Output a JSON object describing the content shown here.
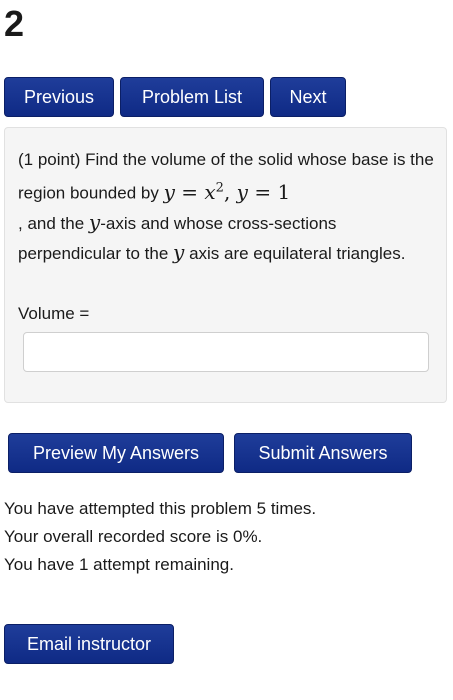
{
  "header": {
    "page_number": "2"
  },
  "nav": {
    "previous_label": "Previous",
    "problem_list_label": "Problem List",
    "next_label": "Next"
  },
  "problem": {
    "points": "(1 point)",
    "text_part1": "Find the volume of the solid whose base is the region bounded by",
    "equation1_lhs": "y",
    "equation1_rhs_base": "x",
    "equation1_exponent": "2",
    "equation2_lhs": "y",
    "equation2_rhs": "1",
    "text_part2": ", and the",
    "axis_var1": "y",
    "text_part3": "-axis and whose cross-sections perpendicular to the",
    "axis_var2": "y",
    "text_part4": "axis are equilateral triangles.",
    "answer_label": "Volume =",
    "answer_value": ""
  },
  "actions": {
    "preview_label": "Preview My Answers",
    "submit_label": "Submit Answers"
  },
  "status": {
    "attempts_line": "You have attempted this problem 5 times.",
    "score_line": "Your overall recorded score is 0%.",
    "remaining_line": "You have 1 attempt remaining."
  },
  "footer": {
    "email_label": "Email instructor"
  }
}
